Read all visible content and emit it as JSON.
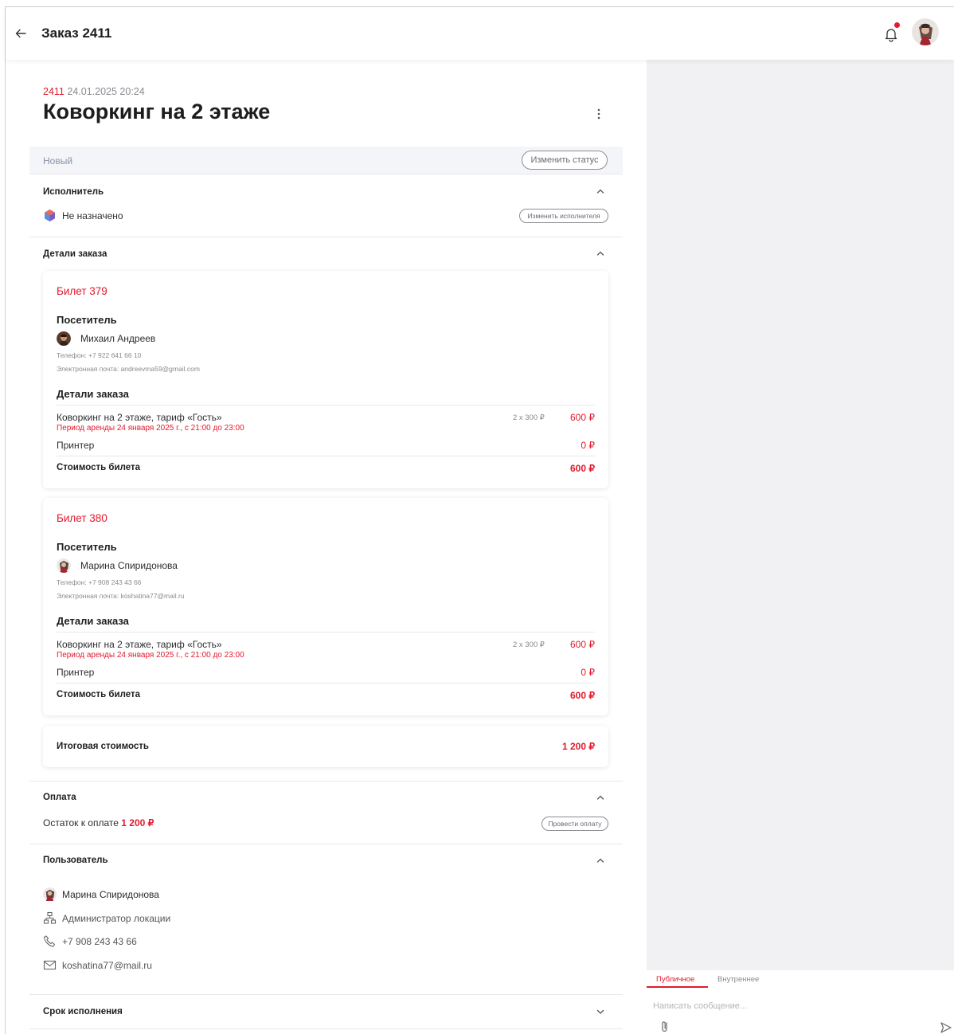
{
  "header": {
    "title": "Заказ 2411"
  },
  "order": {
    "number": "2411",
    "datetime": "24.01.2025 20:24",
    "title": "Коворкинг на 2 этаже",
    "status": "Новый",
    "change_status_label": "Изменить статус"
  },
  "executor": {
    "heading": "Исполнитель",
    "value": "Не назначено",
    "change_label": "Изменить исполнителя"
  },
  "details": {
    "heading": "Детали заказа",
    "tickets": [
      {
        "title": "Билет 379",
        "visitor_heading": "Посетитель",
        "visitor_name": "Михаил Андреев",
        "phone": "Телефон: +7 922 641 66 10",
        "email": "Электронная почта: andreevma59@gmail.com",
        "details_heading": "Детали заказа",
        "item_name": "Коворкинг на 2 этаже, тариф «Гость»",
        "item_period": "Период аренды 24 января 2025 г., с 21:00 до 23:00",
        "item_qty": "2 x 300 ₽",
        "item_price": "600 ₽",
        "extra_name": "Принтер",
        "extra_price": "0 ₽",
        "total_label": "Стоимость билета",
        "total_value": "600 ₽"
      },
      {
        "title": "Билет 380",
        "visitor_heading": "Посетитель",
        "visitor_name": "Марина Спиридонова",
        "phone": "Телефон: +7 908 243 43 66",
        "email": "Электронная почта: koshatina77@mail.ru",
        "details_heading": "Детали заказа",
        "item_name": "Коворкинг на 2 этаже, тариф «Гость»",
        "item_period": "Период аренды 24 января 2025 г., с 21:00 до 23:00",
        "item_qty": "2 x 300 ₽",
        "item_price": "600 ₽",
        "extra_name": "Принтер",
        "extra_price": "0 ₽",
        "total_label": "Стоимость билета",
        "total_value": "600 ₽"
      }
    ],
    "grand_total_label": "Итоговая стоимость",
    "grand_total_value": "1 200 ₽"
  },
  "payment": {
    "heading": "Оплата",
    "remaining_label": "Остаток к оплате",
    "remaining_value": "1 200 ₽",
    "pay_label": "Провести оплату"
  },
  "user": {
    "heading": "Пользователь",
    "name": "Марина Спиридонова",
    "role": "Администратор локации",
    "phone": "+7 908 243 43 66",
    "email": "koshatina77@mail.ru"
  },
  "deadline": {
    "heading": "Срок исполнения"
  },
  "chat": {
    "tab_public": "Публичное",
    "tab_internal": "Внутреннее",
    "placeholder": "Написать сообщение..."
  },
  "colors": {
    "accent": "#e3192d",
    "muted": "#8a8a90",
    "panel": "#f1f1f3"
  }
}
